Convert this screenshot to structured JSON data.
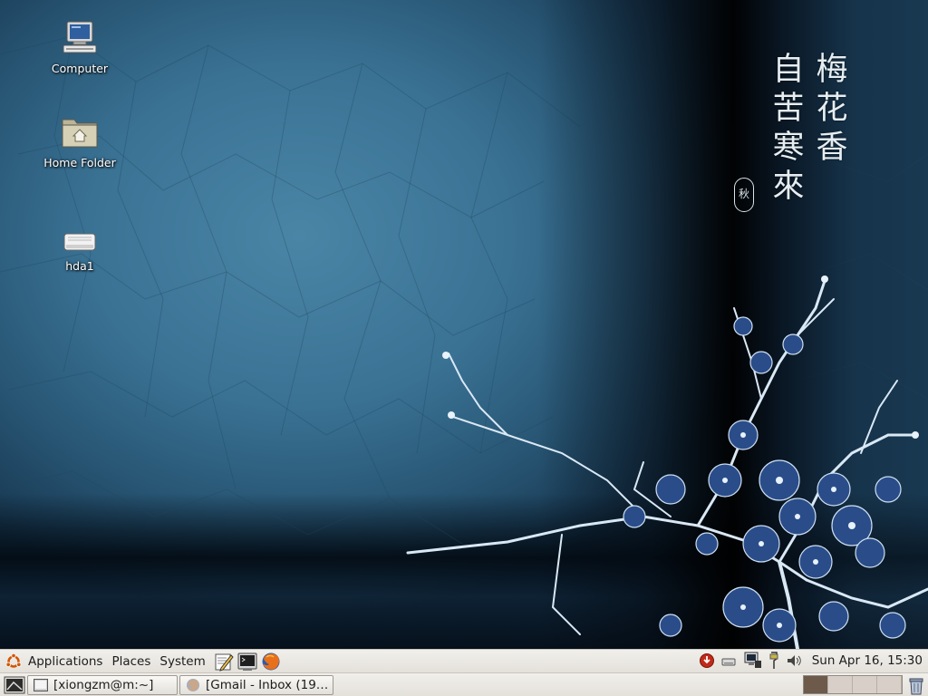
{
  "desktop": {
    "icons": [
      {
        "label": "Computer",
        "icon": "computer-icon"
      },
      {
        "label": "Home Folder",
        "icon": "home-folder-icon"
      },
      {
        "label": "hda1",
        "icon": "drive-icon"
      }
    ],
    "wallpaper": {
      "calligraphy_right": [
        "梅",
        "花",
        "香"
      ],
      "calligraphy_left": [
        "自",
        "苦",
        "寒",
        "來"
      ],
      "seal": "秋",
      "colors": {
        "background": "#3a7294",
        "blossom": "#d9e8f5"
      }
    }
  },
  "top_panel": {
    "menus": [
      "Applications",
      "Places",
      "System"
    ],
    "launchers": [
      "text-editor-icon",
      "terminal-icon",
      "firefox-icon"
    ],
    "tray_icons": [
      "update-notifier-icon",
      "removable-drive-icon",
      "network-monitor-icon",
      "battery-power-icon",
      "volume-icon"
    ],
    "clock": "Sun Apr 16, 15:30"
  },
  "bottom_panel": {
    "tasks": [
      {
        "label": "[xiongzm@m:~]",
        "icon": "terminal-icon"
      },
      {
        "label": "[Gmail - Inbox (19…",
        "icon": "firefox-icon"
      }
    ],
    "workspaces": {
      "count": 4,
      "active_index": 0
    },
    "trash_icon": "trash-icon",
    "colors": {
      "active_workspace": "#6e5a4a",
      "workspace": "#d8d0c8"
    }
  }
}
